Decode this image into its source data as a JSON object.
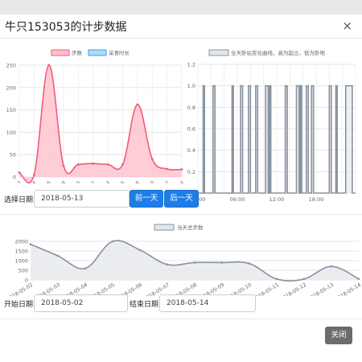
{
  "dialog": {
    "title": "牛只153053的计步数据",
    "close_icon": "×"
  },
  "controls": {
    "select_date_label": "选择日期",
    "select_date_value": "2018-05-13",
    "prev_day_label": "前一天",
    "next_day_label": "后一天",
    "start_date_label": "开始日期",
    "start_date_value": "2018-05-02",
    "end_date_label": "结束日期",
    "end_date_value": "2018-05-14",
    "close_label": "关闭"
  },
  "colors": {
    "steps": "#f25b7b",
    "steps_fill": "#ffc0cc",
    "feeding": "#36a2eb",
    "feeding_fill": "#aedcf7",
    "posture": "#8893a0",
    "primary": "#1e7ee8"
  },
  "chart_data": [
    {
      "type": "area",
      "legend": [
        "步数",
        "采食时长"
      ],
      "categories": [
        "0-2",
        "2-4",
        "4-6",
        "6-8",
        "8-10",
        "10-12",
        "12-14",
        "14-16",
        "16-18",
        "18-20",
        "20-22",
        "22-24"
      ],
      "series": [
        {
          "name": "步数",
          "values": [
            10,
            5,
            250,
            25,
            28,
            30,
            28,
            28,
            162,
            40,
            18,
            17
          ]
        },
        {
          "name": "采食时长",
          "values": []
        }
      ],
      "ylim": [
        0,
        250
      ],
      "yticks": [
        0,
        50,
        100,
        150,
        200,
        250
      ],
      "legend_position": "top",
      "grid": true
    },
    {
      "type": "line",
      "legend": [
        "全天卧站变化曲线，高为起立，低为卧地"
      ],
      "x_ticks": [
        "00:00",
        "06:00",
        "12:00",
        "18:00"
      ],
      "ylim": [
        0,
        1.2
      ],
      "yticks": [
        "0.0",
        "0.2",
        "0.4",
        "0.6",
        "0.8",
        "1.0",
        "1.2"
      ],
      "segments_high_hours": [
        [
          0.8,
          1.0
        ],
        [
          2.3,
          2.6
        ],
        [
          5.2,
          5.4
        ],
        [
          6.5,
          6.8
        ],
        [
          7.7,
          8.0
        ],
        [
          8.8,
          9.1
        ],
        [
          10.3,
          10.7
        ],
        [
          10.9,
          11.1
        ],
        [
          13.3,
          13.6
        ],
        [
          15.0,
          15.4
        ],
        [
          15.6,
          15.8
        ],
        [
          16.5,
          16.8
        ],
        [
          17.3,
          17.6
        ],
        [
          20.0,
          20.3
        ],
        [
          21.0,
          21.2
        ],
        [
          22.5,
          23.5
        ]
      ],
      "legend_position": "top",
      "grid": true
    },
    {
      "type": "area",
      "legend": [
        "当天总步数"
      ],
      "categories": [
        "2018-05-02",
        "2018-05-03",
        "2018-05-04",
        "2018-05-05",
        "2018-05-06",
        "2018-05-07",
        "2018-05-08",
        "2018-05-09",
        "2018-05-10",
        "2018-05-11",
        "2018-05-12",
        "2018-05-13",
        "2018-05-14"
      ],
      "series": [
        {
          "name": "当天总步数",
          "values": [
            1850,
            1250,
            600,
            2000,
            1550,
            800,
            900,
            900,
            850,
            50,
            50,
            700,
            50
          ]
        }
      ],
      "ylim": [
        0,
        2000
      ],
      "yticks": [
        0,
        500,
        1000,
        1500,
        2000
      ],
      "legend_position": "top",
      "grid": true
    }
  ]
}
